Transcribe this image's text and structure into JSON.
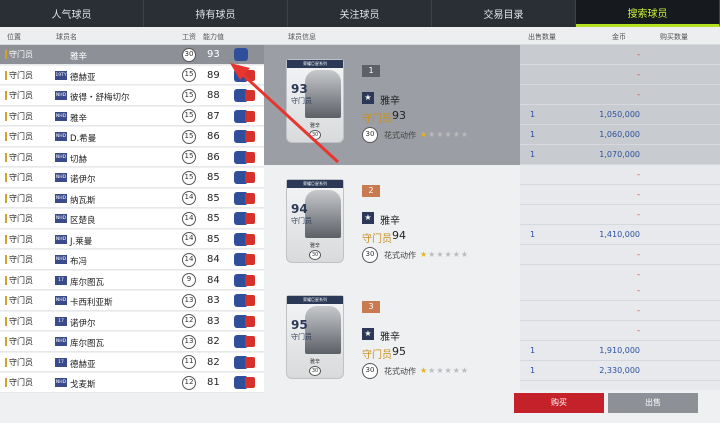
{
  "tabs": [
    "人气球员",
    "持有球员",
    "关注球员",
    "交易目录",
    "搜索球员"
  ],
  "active_tab_index": 4,
  "list_header": {
    "position": "位置",
    "name": "球员名",
    "wage": "工资",
    "rating": "能力值"
  },
  "market_header": {
    "player_info": "球员信息",
    "quantity": "出售数量",
    "coins": "金币",
    "buy_quantity": "购买数量"
  },
  "players": [
    {
      "pos": "守门员",
      "badge": "",
      "name": "雅辛",
      "wage": "30",
      "rating": "93"
    },
    {
      "pos": "守门员",
      "badge": "19TY",
      "name": "德赫亚",
      "wage": "15",
      "rating": "89"
    },
    {
      "pos": "守门员",
      "badge": "NHD",
      "name": "彼得・舒梅切尔",
      "wage": "15",
      "rating": "88"
    },
    {
      "pos": "守门员",
      "badge": "NHD",
      "name": "雅辛",
      "wage": "15",
      "rating": "87"
    },
    {
      "pos": "守门员",
      "badge": "NHD",
      "name": "D.希曼",
      "wage": "15",
      "rating": "86"
    },
    {
      "pos": "守门员",
      "badge": "NHD",
      "name": "切赫",
      "wage": "15",
      "rating": "86"
    },
    {
      "pos": "守门员",
      "badge": "NHD",
      "name": "诺伊尔",
      "wage": "15",
      "rating": "85"
    },
    {
      "pos": "守门员",
      "badge": "NHD",
      "name": "纳瓦斯",
      "wage": "14",
      "rating": "85"
    },
    {
      "pos": "守门员",
      "badge": "NHD",
      "name": "区楚良",
      "wage": "14",
      "rating": "85"
    },
    {
      "pos": "守门员",
      "badge": "NHD",
      "name": "J.莱曼",
      "wage": "14",
      "rating": "85"
    },
    {
      "pos": "守门员",
      "badge": "NHD",
      "name": "布冯",
      "wage": "14",
      "rating": "84"
    },
    {
      "pos": "守门员",
      "badge": "17",
      "name": "库尔图瓦",
      "wage": "9",
      "rating": "84"
    },
    {
      "pos": "守门员",
      "badge": "NHD",
      "name": "卡西利亚斯",
      "wage": "13",
      "rating": "83"
    },
    {
      "pos": "守门员",
      "badge": "17",
      "name": "诺伊尔",
      "wage": "12",
      "rating": "83"
    },
    {
      "pos": "守门员",
      "badge": "NHD",
      "name": "库尔图瓦",
      "wage": "13",
      "rating": "82"
    },
    {
      "pos": "守门员",
      "badge": "17",
      "name": "德赫亚",
      "wage": "11",
      "rating": "82"
    },
    {
      "pos": "守门员",
      "badge": "NHD",
      "name": "戈麦斯",
      "wage": "12",
      "rating": "81"
    }
  ],
  "offers": [
    {
      "index": "1",
      "name": "雅辛",
      "position": "守门员",
      "rating": "93",
      "wage": "30",
      "skill": "花式动作",
      "stars": 1,
      "card_rating": "93",
      "card_pos": "守门员",
      "card_top": "荣耀巨星系列",
      "card_name": "雅辛",
      "market": [
        {
          "q": "",
          "c": "-"
        },
        {
          "q": "",
          "c": "-"
        },
        {
          "q": "",
          "c": "-"
        },
        {
          "q": "1",
          "c": "1,050,000"
        },
        {
          "q": "1",
          "c": "1,060,000"
        },
        {
          "q": "1",
          "c": "1,070,000"
        }
      ]
    },
    {
      "index": "2",
      "name": "雅辛",
      "position": "守门员",
      "rating": "94",
      "wage": "30",
      "skill": "花式动作",
      "stars": 1,
      "card_rating": "94",
      "card_pos": "守门员",
      "card_top": "荣耀巨星系列",
      "card_name": "雅辛",
      "market": [
        {
          "q": "",
          "c": "-"
        },
        {
          "q": "",
          "c": "-"
        },
        {
          "q": "",
          "c": "-"
        },
        {
          "q": "1",
          "c": "1,410,000"
        },
        {
          "q": "",
          "c": "-"
        },
        {
          "q": "",
          "c": "-"
        }
      ]
    },
    {
      "index": "3",
      "name": "雅辛",
      "position": "守门员",
      "rating": "95",
      "wage": "30",
      "skill": "花式动作",
      "stars": 1,
      "card_rating": "95",
      "card_pos": "守门员",
      "card_top": "荣耀巨星系列",
      "card_name": "雅辛",
      "market": [
        {
          "q": "",
          "c": "-"
        },
        {
          "q": "",
          "c": "-"
        },
        {
          "q": "",
          "c": "-"
        },
        {
          "q": "1",
          "c": "1,910,000"
        },
        {
          "q": "1",
          "c": "2,330,000"
        },
        {
          "q": "",
          "c": "-"
        }
      ]
    }
  ],
  "buttons": {
    "buy": "购买",
    "sell": "出售"
  },
  "colors": {
    "accent": "#b7e020",
    "buy": "#c4212a",
    "link": "#2a4fa0",
    "annotation_arrow": "#e8352e"
  }
}
